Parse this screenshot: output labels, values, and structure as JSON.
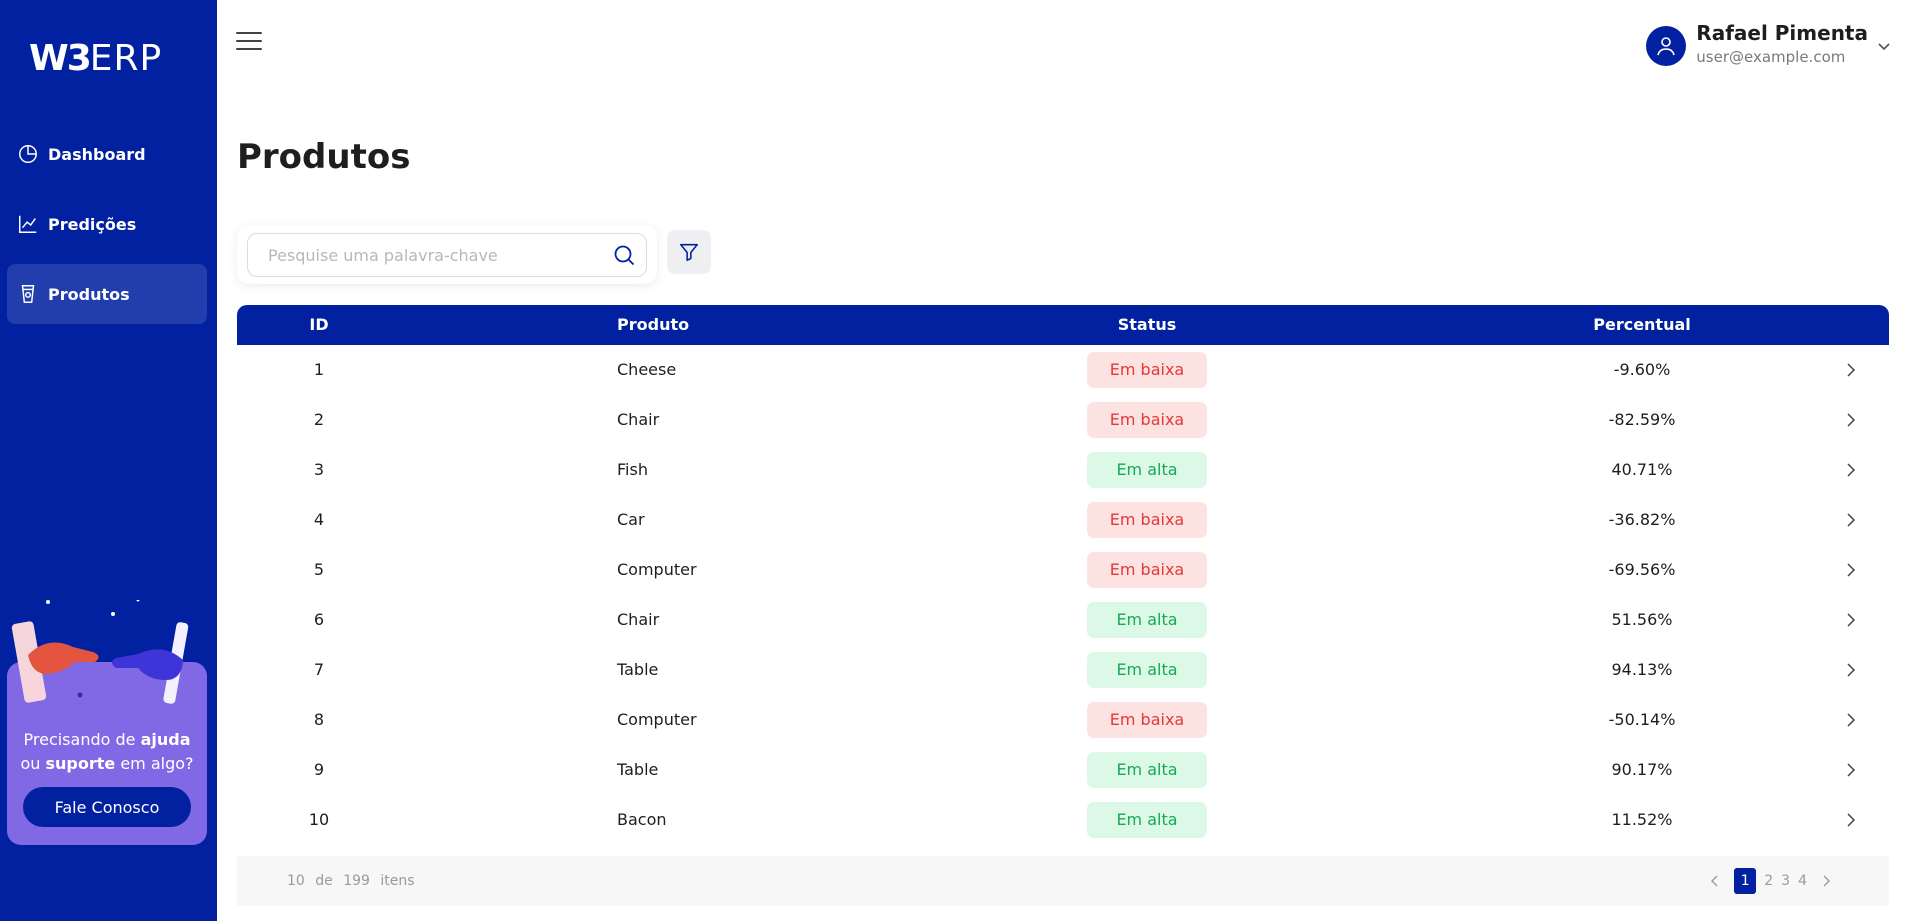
{
  "logo": {
    "bold": "W3",
    "thin": "ERP"
  },
  "sidebar": {
    "items": [
      {
        "label": "Dashboard",
        "icon": "pie-chart-icon",
        "active": false
      },
      {
        "label": "Predições",
        "icon": "line-chart-icon",
        "active": false
      },
      {
        "label": "Produtos",
        "icon": "product-icon",
        "active": true
      }
    ],
    "help": {
      "line1_prefix": "Precisando de ",
      "line1_bold": "ajuda",
      "line2_prefix": "ou ",
      "line2_bold": "suporte",
      "line2_suffix": " em algo?",
      "button_label": "Fale Conosco"
    }
  },
  "header": {
    "user_name": "Rafael Pimenta",
    "user_email": "user@example.com"
  },
  "page": {
    "title": "Produtos"
  },
  "search": {
    "placeholder": "Pesquise uma palavra-chave",
    "value": ""
  },
  "table": {
    "columns": [
      "ID",
      "Produto",
      "Status",
      "Percentual"
    ],
    "rows": [
      {
        "id": "1",
        "product": "Cheese",
        "status": "Em baixa",
        "trend": "down",
        "percent": "-9.60%"
      },
      {
        "id": "2",
        "product": "Chair",
        "status": "Em baixa",
        "trend": "down",
        "percent": "-82.59%"
      },
      {
        "id": "3",
        "product": "Fish",
        "status": "Em alta",
        "trend": "up",
        "percent": "40.71%"
      },
      {
        "id": "4",
        "product": "Car",
        "status": "Em baixa",
        "trend": "down",
        "percent": "-36.82%"
      },
      {
        "id": "5",
        "product": "Computer",
        "status": "Em baixa",
        "trend": "down",
        "percent": "-69.56%"
      },
      {
        "id": "6",
        "product": "Chair",
        "status": "Em alta",
        "trend": "up",
        "percent": "51.56%"
      },
      {
        "id": "7",
        "product": "Table",
        "status": "Em alta",
        "trend": "up",
        "percent": "94.13%"
      },
      {
        "id": "8",
        "product": "Computer",
        "status": "Em baixa",
        "trend": "down",
        "percent": "-50.14%"
      },
      {
        "id": "9",
        "product": "Table",
        "status": "Em alta",
        "trend": "up",
        "percent": "90.17%"
      },
      {
        "id": "10",
        "product": "Bacon",
        "status": "Em alta",
        "trend": "up",
        "percent": "11.52%"
      }
    ]
  },
  "pagination": {
    "shown": "10",
    "of_label": "de",
    "total": "199",
    "items_label": "itens",
    "pages": [
      "1",
      "2",
      "3",
      "4"
    ],
    "current_page": "1"
  },
  "colors": {
    "brand": "#0221a0",
    "help_card": "#8169e6",
    "down_bg": "#fde2e2",
    "down_text": "#e53838",
    "up_bg": "#dbf9e6",
    "up_text": "#18a956"
  }
}
